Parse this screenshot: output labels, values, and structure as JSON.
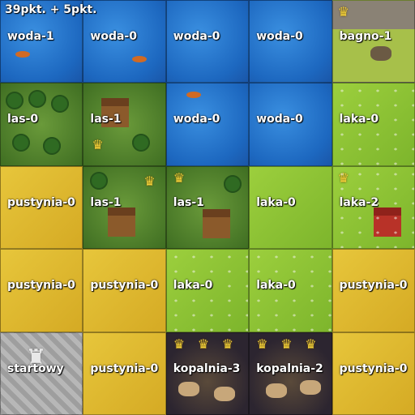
{
  "score": "39pkt. + 5pkt.",
  "colors": {
    "woda": "#1d68c0",
    "bagno": "#8a8275",
    "las": "#4f7d2a",
    "laka": "#8ec535",
    "pustynia": "#deb830",
    "startowy": "#a9a9a9",
    "kopalnia": "#3a2f33",
    "crown": "#f1d03a"
  },
  "tiles": [
    {
      "label": "woda-1",
      "terrain": "woda",
      "crowns": 1
    },
    {
      "label": "woda-0",
      "terrain": "woda",
      "crowns": 0
    },
    {
      "label": "woda-0",
      "terrain": "woda",
      "crowns": 0
    },
    {
      "label": "woda-0",
      "terrain": "woda",
      "crowns": 0
    },
    {
      "label": "bagno-1",
      "terrain": "bagno",
      "crowns": 1
    },
    {
      "label": "las-0",
      "terrain": "las",
      "crowns": 0
    },
    {
      "label": "las-1",
      "terrain": "las",
      "crowns": 1
    },
    {
      "label": "woda-0",
      "terrain": "woda",
      "crowns": 0
    },
    {
      "label": "woda-0",
      "terrain": "woda",
      "crowns": 0
    },
    {
      "label": "laka-0",
      "terrain": "laka",
      "crowns": 0
    },
    {
      "label": "pustynia-0",
      "terrain": "pustynia",
      "crowns": 0
    },
    {
      "label": "las-1",
      "terrain": "las",
      "crowns": 1
    },
    {
      "label": "las-1",
      "terrain": "las",
      "crowns": 1
    },
    {
      "label": "laka-0",
      "terrain": "laka",
      "crowns": 0
    },
    {
      "label": "laka-2",
      "terrain": "laka",
      "crowns": 2
    },
    {
      "label": "pustynia-0",
      "terrain": "pustynia",
      "crowns": 0
    },
    {
      "label": "pustynia-0",
      "terrain": "pustynia",
      "crowns": 0
    },
    {
      "label": "laka-0",
      "terrain": "laka",
      "crowns": 0
    },
    {
      "label": "laka-0",
      "terrain": "laka",
      "crowns": 0
    },
    {
      "label": "pustynia-0",
      "terrain": "pustynia",
      "crowns": 0
    },
    {
      "label": "startowy",
      "terrain": "startowy",
      "crowns": 0
    },
    {
      "label": "pustynia-0",
      "terrain": "pustynia",
      "crowns": 0
    },
    {
      "label": "kopalnia-3",
      "terrain": "kopalnia",
      "crowns": 3
    },
    {
      "label": "kopalnia-2",
      "terrain": "kopalnia",
      "crowns": 2
    },
    {
      "label": "pustynia-0",
      "terrain": "pustynia",
      "crowns": 0
    }
  ]
}
